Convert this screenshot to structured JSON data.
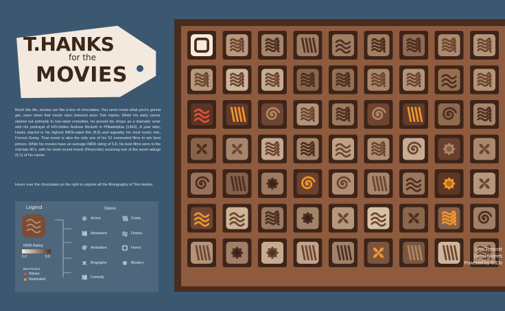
{
  "title": {
    "line1": "T.HANKS",
    "line2": "for the",
    "line3": "MOVIES"
  },
  "intro": "Much like life, movies are like a box of chocolates. You never know what you're gonna get...even when that movie stars beloved actor Tom Hanks. While his early career started out primarily in low-rated comedies, he proved his chops as a dramatic actor with his portrayal of HIV-ridden Andrew Beckett in Philadelphia (1993). A year later, Hanks starred in his highest IMDb-rated film (8.8) and arguably his most iconic role, Forrest Gump. That movie is also the only one of his 10 nominated films to win best picture. While his movies have an average IMDb rating of 6.8, his best films were in the mid-late 90's, with his most recent movie (Pinocchio) receiving one of the worst ratings (5.1) of his career.",
  "hover_note": "Hover over the chocolates on the right to explore all the filmography of Tom Hanks.",
  "legend": {
    "title": "Legend",
    "genre_title": "Genre",
    "rating_label": "IMDB Rating",
    "rating_min": "5.0",
    "rating_max": "8.8",
    "best_picture_label": "Best Picture",
    "winner": "Winner",
    "nominated": "Nominated",
    "winner_color": "#e0503c",
    "nominated_color": "#f0962a",
    "genres_left": [
      "Action",
      "Adventure",
      "Animation",
      "Biography",
      "Comedy"
    ],
    "genres_right": [
      "Crime",
      "Drama",
      "Horror",
      "Mystery"
    ],
    "genre_icons_left": [
      "dot-ring-icon",
      "swirl-icon",
      "spiral-icon",
      "cross-petal-icon",
      "scribble-icon"
    ],
    "genre_icons_right": [
      "lines-icon",
      "wave-icon",
      "square-icon",
      "flower-icon"
    ]
  },
  "credits": {
    "author": "Lisa Trescott",
    "source": "Data+Movies",
    "powered": "Powered by IMDb"
  },
  "chocolates": [
    [
      "square",
      "scribble",
      "scribble",
      "lines",
      "wave",
      "scribble",
      "scribble",
      "scribble",
      "scribble"
    ],
    [
      "scribble",
      "scribble",
      "scribble",
      "scribble",
      "scribble",
      "scribble",
      "scribble",
      "wave",
      "scribble"
    ],
    [
      "wave",
      "lines",
      "spiral",
      "scribble",
      "scribble",
      "spiral",
      "lines",
      "spiral",
      "scribble"
    ],
    [
      "cross",
      "cross",
      "scribble",
      "scribble",
      "wave",
      "scribble",
      "spiral",
      "flower",
      "cross"
    ],
    [
      "spiral",
      "lines",
      "flower",
      "spiral",
      "spiral",
      "lines",
      "wave",
      "flower",
      "cross"
    ],
    [
      "wave",
      "wave",
      "scribble",
      "flower",
      "cross",
      "wave",
      "cross",
      "scribble",
      "spiral"
    ],
    [
      "lines",
      "flower",
      "flower",
      "lines",
      "lines",
      "cross",
      "lines",
      "lines",
      "scribble"
    ]
  ],
  "accents": [
    [
      null,
      null,
      null,
      null,
      null,
      null,
      null,
      null,
      null
    ],
    [
      null,
      null,
      null,
      null,
      null,
      null,
      null,
      null,
      null
    ],
    [
      "winner",
      "nominated",
      null,
      null,
      null,
      null,
      "nominated",
      null,
      null
    ],
    [
      null,
      null,
      null,
      null,
      null,
      null,
      null,
      null,
      null
    ],
    [
      null,
      null,
      null,
      "nominated",
      null,
      null,
      null,
      "nominated",
      null
    ],
    [
      "nominated",
      null,
      null,
      null,
      null,
      null,
      null,
      "nominated",
      null
    ],
    [
      null,
      null,
      null,
      null,
      null,
      "nominated",
      null,
      null,
      null
    ]
  ],
  "shades": [
    [
      "#f6ebdc",
      "#b8997d",
      "#a7856a",
      "#a07e63",
      "#9f7e62",
      "#a27f64",
      "#8e6a50",
      "#ac8a6e",
      "#b4977b"
    ],
    [
      "#b6997b",
      "#cdb59b",
      "#c5ab90",
      "#8a654a",
      "#946f53",
      "#a9876c",
      "#b39479",
      "#976f4e",
      "#b39478"
    ],
    [
      "#5a3424",
      "#603a28",
      "#6e4431",
      "#b39479",
      "#9c7a5f",
      "#6f4532",
      "#623b2a",
      "#8f6a4f",
      "#a7856b"
    ],
    [
      "#88634a",
      "#a7856c",
      "#c4a98f",
      "#a7856b",
      "#bfa185",
      "#b09176",
      "#c6ac92",
      "#6a402f",
      "#aa886d"
    ],
    [
      "#98735a",
      "#84604a",
      "#9d7a60",
      "#6b412f",
      "#b08f74",
      "#a7866b",
      "#9a775d",
      "#5d3726",
      "#b5977c"
    ],
    [
      "#6f4634",
      "#cdb597",
      "#9d7b62",
      "#a3826a",
      "#b6987d",
      "#d6c1a6",
      "#8b664c",
      "#86604a",
      "#a27f67"
    ],
    [
      "#b2947a",
      "#a17f66",
      "#c6ab90",
      "#c1a58b",
      "#a1826a",
      "#7b5440",
      "#7a563f",
      "#cfb79c",
      "#a8876d"
    ]
  ]
}
